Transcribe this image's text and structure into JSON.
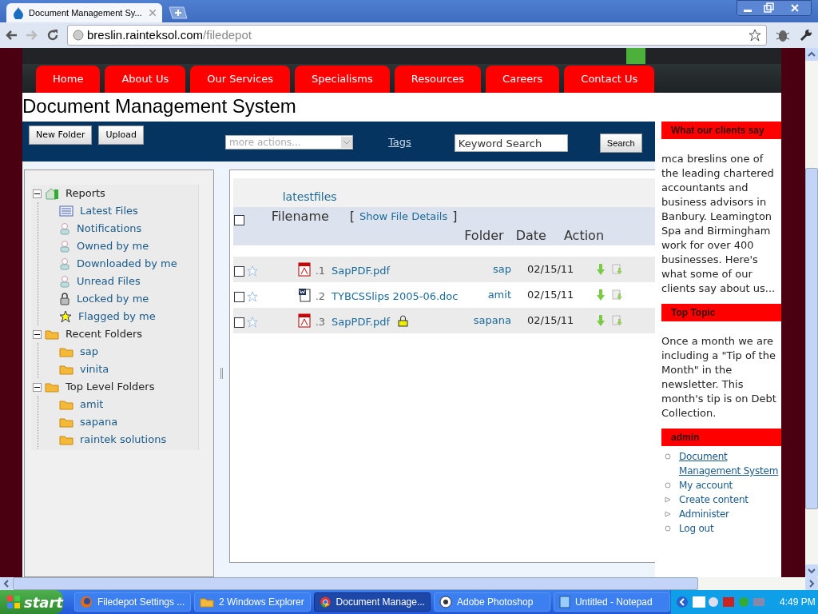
{
  "browser": {
    "tab_title": "Document Management Sy...",
    "url_host": "breslin.rainteksol.com",
    "url_path": "/filedepot"
  },
  "nav": [
    {
      "label": "Home"
    },
    {
      "label": "About Us"
    },
    {
      "label": "Our Services"
    },
    {
      "label": "Specialisms"
    },
    {
      "label": "Resources"
    },
    {
      "label": "Careers"
    },
    {
      "label": "Contact Us"
    }
  ],
  "page_title": "Document Management System",
  "toolbar": {
    "buttons": [
      "New Folder",
      "Upload"
    ],
    "actions_placeholder": "more actions...",
    "tags_link": "Tags",
    "search_placeholder": "Keyword Search",
    "search_button": "Search"
  },
  "tree": [
    {
      "label": "Reports",
      "kind": "reports",
      "expanded": true,
      "children": [
        {
          "label": "Latest Files",
          "kind": "list"
        },
        {
          "label": "Notifications",
          "kind": "person"
        },
        {
          "label": "Owned by me",
          "kind": "person"
        },
        {
          "label": "Downloaded by me",
          "kind": "person"
        },
        {
          "label": "Unread Files",
          "kind": "person"
        },
        {
          "label": "Locked by me",
          "kind": "lock"
        },
        {
          "label": "Flagged by me",
          "kind": "star"
        }
      ]
    },
    {
      "label": "Recent Folders",
      "kind": "folder",
      "expanded": true,
      "children": [
        {
          "label": "sap",
          "kind": "folder"
        },
        {
          "label": "vinita",
          "kind": "folder"
        }
      ]
    },
    {
      "label": "Top Level Folders",
      "kind": "folder",
      "expanded": true,
      "children": [
        {
          "label": "amit",
          "kind": "folder"
        },
        {
          "label": "sapana",
          "kind": "folder"
        },
        {
          "label": "raintek solutions",
          "kind": "folder"
        }
      ]
    }
  ],
  "files": {
    "heading": "latestfiles",
    "all_checked": false,
    "columns": {
      "filename": "Filename",
      "bracket_open": "[",
      "details_link": "Show File Details",
      "bracket_close": "]",
      "folder": "Folder",
      "date": "Date",
      "action": "Action"
    },
    "rows": [
      {
        "checked": false,
        "flagged": false,
        "kind": "pdf",
        "index": ".1",
        "name": "SapPDF.pdf",
        "locked": false,
        "folder": "sap",
        "date": "02/15/11"
      },
      {
        "checked": false,
        "flagged": false,
        "kind": "doc",
        "index": ".2",
        "name": "TYBCSSlips 2005-06.doc",
        "locked": false,
        "folder": "amit",
        "date": "02/15/11"
      },
      {
        "checked": false,
        "flagged": false,
        "kind": "pdf",
        "index": ".3",
        "name": "SapPDF.pdf",
        "locked": true,
        "folder": "sapana",
        "date": "02/15/11"
      }
    ]
  },
  "sidebar": [
    {
      "title": "What our clients say",
      "text": "mca breslins one of the leading chartered accountants and business advisors in Banbury. Leamington Spa and Birmingham work for over 400 businesses. Here's what some of our clients say about us..."
    },
    {
      "title": "Top Topic",
      "text": "Once a month we are including a \"Tip of the Month\" in the newsletter. This month's tip is on Debt Collection."
    },
    {
      "title": "admin",
      "links": [
        {
          "label": "Document Management System",
          "kind": "leaf",
          "underlined": true
        },
        {
          "label": "My account",
          "kind": "leaf",
          "underlined": false
        },
        {
          "label": "Create content",
          "kind": "collapsed",
          "underlined": false
        },
        {
          "label": "Administer",
          "kind": "collapsed",
          "underlined": false
        },
        {
          "label": "Log out",
          "kind": "leaf",
          "underlined": false
        }
      ]
    }
  ],
  "taskbar": {
    "start": "start",
    "items": [
      {
        "label": "Filedepot Settings ...",
        "kind": "firefox",
        "selected": false
      },
      {
        "label": "2 Windows Explorer",
        "kind": "folder",
        "selected": false
      },
      {
        "label": "Document Manage...",
        "kind": "chrome",
        "selected": true
      },
      {
        "label": "Adobe Photoshop",
        "kind": "photoshop",
        "selected": false
      },
      {
        "label": "Untitled - Notepad",
        "kind": "notepad",
        "selected": false
      }
    ],
    "time": "4:49 PM"
  }
}
